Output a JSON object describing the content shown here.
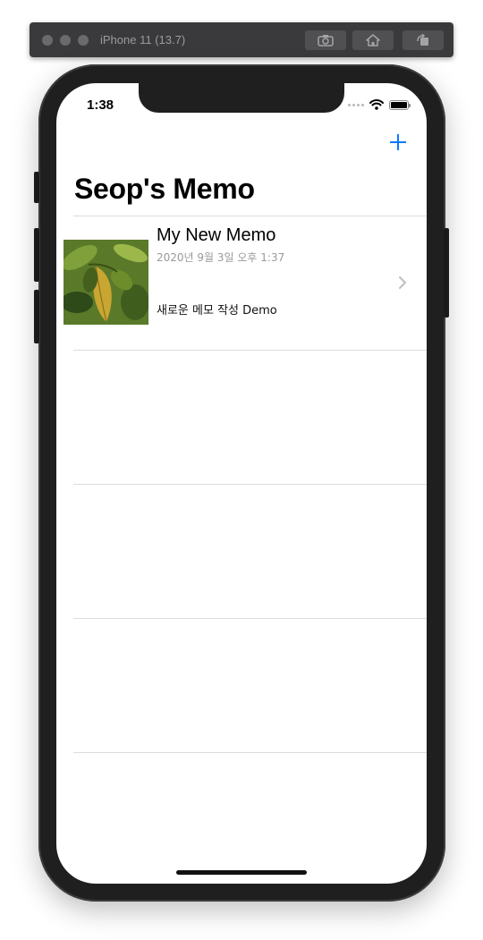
{
  "simulator": {
    "title": "iPhone 11 (13.7)",
    "buttons": [
      {
        "icon": "screenshot-icon"
      },
      {
        "icon": "home-icon"
      },
      {
        "icon": "rotate-icon"
      }
    ]
  },
  "status_bar": {
    "time": "1:38",
    "icons": [
      "signal-dots-icon",
      "wifi-icon",
      "battery-icon"
    ],
    "battery_level": 1.0
  },
  "nav": {
    "add_icon": "plus-icon",
    "title": "Seop's Memo"
  },
  "memos": [
    {
      "title": "My New Memo",
      "date": "2020년 9월 3일 오후 1:37",
      "body": "새로운 메모 작성 Demo",
      "thumbnail": "leaf-photo",
      "accessory": "chevron-right-icon"
    }
  ],
  "colors": {
    "accent": "#0a7aff",
    "separator": "#dcdcdc",
    "secondary_text": "#9a9a9a"
  }
}
